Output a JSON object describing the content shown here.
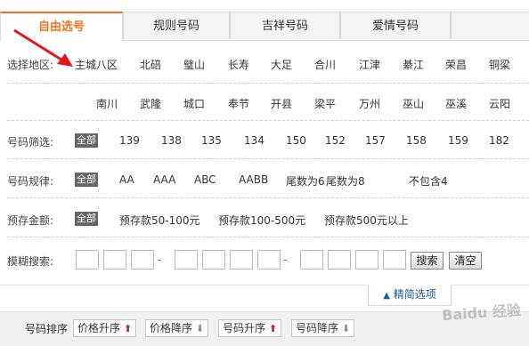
{
  "tabs": [
    "自由选号",
    "规则号码",
    "吉祥号码",
    "爱情号码"
  ],
  "region": {
    "label": "选择地区:",
    "row1": [
      "主城八区",
      "北碚",
      "璧山",
      "长寿",
      "大足",
      "合川",
      "江津",
      "綦江",
      "荣昌",
      "铜梁"
    ],
    "row2": [
      "南川",
      "武隆",
      "城口",
      "奉节",
      "开县",
      "梁平",
      "万州",
      "巫山",
      "巫溪",
      "云阳"
    ]
  },
  "prefix": {
    "label": "号码筛选:",
    "all": "全部",
    "options": [
      "139",
      "138",
      "135",
      "134",
      "150",
      "152",
      "157",
      "158",
      "159",
      "182"
    ]
  },
  "pattern": {
    "label": "号码规律:",
    "all": "全部",
    "options": [
      "AA",
      "AAA",
      "ABC",
      "AABB",
      "尾数为6",
      "尾数为8",
      "不包含4"
    ]
  },
  "deposit": {
    "label": "预存金额:",
    "all": "全部",
    "options": [
      "预存款50-100元",
      "预存款100-500元",
      "预存款500元以上"
    ]
  },
  "fuzzy": {
    "label": "模糊搜索:",
    "separator": "-",
    "search_button": "搜索",
    "clear_button": "清空"
  },
  "toggle_label": "精简选项",
  "sort": {
    "label": "号码排序",
    "buttons": [
      {
        "label": "价格升序",
        "dir": "up"
      },
      {
        "label": "价格降序",
        "dir": "down"
      },
      {
        "label": "号码升序",
        "dir": "up"
      },
      {
        "label": "号码降序",
        "dir": "down"
      }
    ]
  },
  "watermark": "Baidu 经验",
  "colors": {
    "accent": "#f0731e",
    "arrow": "#e8141b",
    "link": "#1a5aa6"
  }
}
